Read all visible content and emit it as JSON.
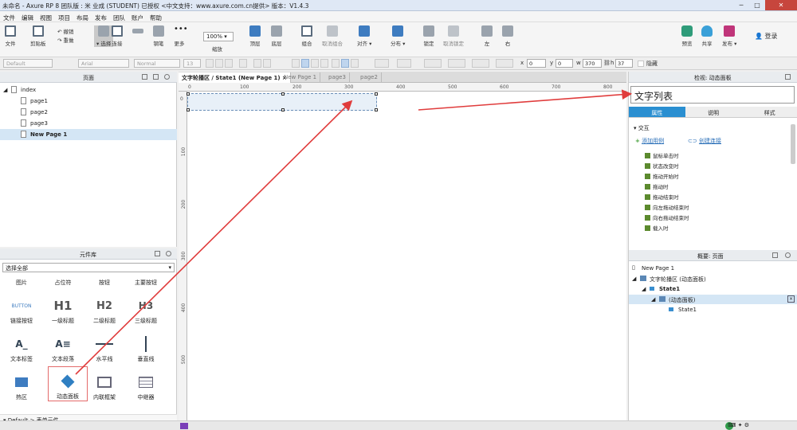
{
  "window": {
    "title": "未命名 - Axure RP 8 团队版 : 米 业成 (STUDENT) 已授权    <中文支持：www.axure.com.cn提供> 版本：V1.4.3"
  },
  "menu": [
    "文件",
    "编辑",
    "视图",
    "项目",
    "布局",
    "发布",
    "团队",
    "账户",
    "帮助"
  ],
  "toolbar": {
    "file": "文件",
    "clipboard": "剪贴板",
    "undo": "撤销",
    "redo": "重做",
    "select": "选择",
    "connect": "连接",
    "pen": "钢笔",
    "more": "更多",
    "zoom_value": "100%",
    "zoom_label": "缩放",
    "top": "顶层",
    "bottom": "底层",
    "group": "组合",
    "ungroup": "取消组合",
    "align": "对齐",
    "distribute": "分布",
    "lock": "锁定",
    "unlock": "取消锁定",
    "left": "左",
    "right": "右",
    "preview": "预览",
    "share": "共享",
    "publish": "发布",
    "login": "登录"
  },
  "format": {
    "style": "Default",
    "font": "Arial",
    "weight": "Normal",
    "size": "13",
    "x_label": "x",
    "x": "0",
    "y_label": "y",
    "y": "0",
    "w_label": "w",
    "w": "370",
    "h_label": "h",
    "h": "37",
    "hidden": "隐藏"
  },
  "pages_panel": {
    "title": "页面",
    "items": [
      {
        "name": "index",
        "level": 0
      },
      {
        "name": "page1",
        "level": 1
      },
      {
        "name": "page2",
        "level": 1
      },
      {
        "name": "page3",
        "level": 1
      },
      {
        "name": "New Page 1",
        "level": 1,
        "selected": true
      }
    ]
  },
  "library": {
    "title": "元件库",
    "filter": "选择全部",
    "row0": [
      "图片",
      "占位符",
      "按钮",
      "主要按钮"
    ],
    "widgets": [
      {
        "label": "链接按钮",
        "glyph": "BUTTON"
      },
      {
        "label": "一级标题",
        "glyph": "H1"
      },
      {
        "label": "二级标题",
        "glyph": "H2"
      },
      {
        "label": "三级标题",
        "glyph": "H3"
      },
      {
        "label": "文本标签",
        "glyph": "A_"
      },
      {
        "label": "文本段落",
        "glyph": "A≡"
      },
      {
        "label": "水平线",
        "glyph": "—"
      },
      {
        "label": "垂直线",
        "glyph": "|"
      },
      {
        "label": "热区",
        "glyph": ""
      },
      {
        "label": "动态面板",
        "glyph": "",
        "highlighted": true
      },
      {
        "label": "内联框架",
        "glyph": ""
      },
      {
        "label": "中继器",
        "glyph": ""
      }
    ],
    "footer": "Default > 表单元件"
  },
  "tabs": [
    {
      "label": "文字轮播区 / State1 (New Page 1)",
      "active": true
    },
    {
      "label": "New Page 1",
      "active": false
    },
    {
      "label": "page3",
      "active": false
    },
    {
      "label": "page2",
      "active": false
    }
  ],
  "ruler": {
    "h": [
      "0",
      "100",
      "200",
      "300",
      "400",
      "500",
      "600",
      "700",
      "800"
    ],
    "v": [
      "0",
      "100",
      "200",
      "300",
      "400",
      "500"
    ]
  },
  "inspector": {
    "title": "检视: 动态面板",
    "name_value": "文字列表",
    "tabs": [
      "属性",
      "说明",
      "样式"
    ],
    "interaction": "交互",
    "add_case": "添加用例",
    "create_link": "创建连接",
    "events": [
      "鼠标单击时",
      "状态改变时",
      "拖动开始时",
      "拖动时",
      "拖动结束时",
      "向左拖动结束时",
      "向右拖动结束时",
      "载入时"
    ]
  },
  "outline": {
    "title": "概要: 页面",
    "items": [
      {
        "label": "New Page 1",
        "level": 0
      },
      {
        "label": "文字轮播区 (动态面板)",
        "level": 1
      },
      {
        "label": "State1",
        "level": 2
      },
      {
        "label": "(动态面板)",
        "level": 3,
        "selected": true
      },
      {
        "label": "State1",
        "level": 4
      }
    ]
  },
  "colors": {
    "accent": "#2a8fd1",
    "arrow": "#e03c3c",
    "selection": "#d4e6f5"
  }
}
